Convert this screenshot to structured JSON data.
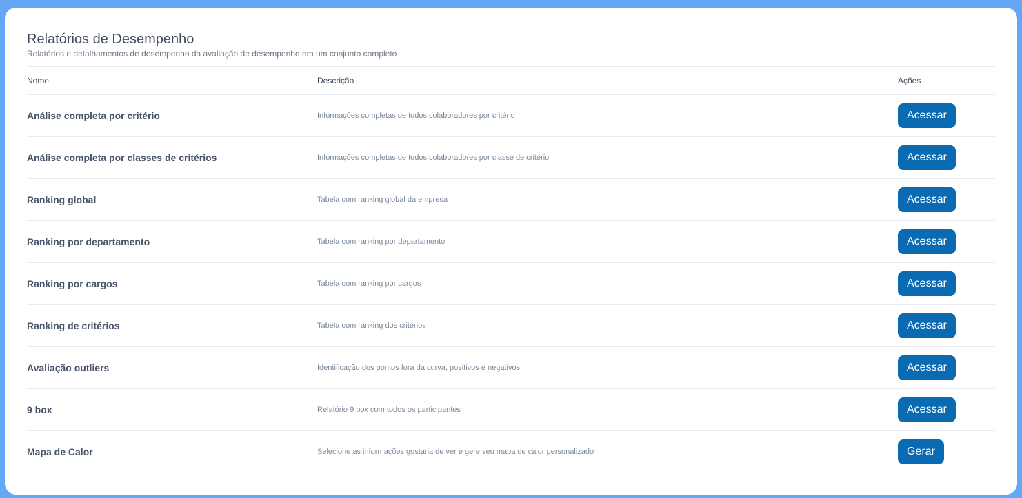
{
  "header": {
    "title": "Relatórios de Desempenho",
    "subtitle": "Relatórios e detalhamentos de desempenho da avaliação de desempenho em um conjunto completo"
  },
  "table": {
    "columns": {
      "name": "Nome",
      "description": "Descrição",
      "actions": "Ações"
    },
    "rows": [
      {
        "name": "Análise completa por critério",
        "description": "Informações completas de todos colaboradores por critério",
        "action": "Acessar"
      },
      {
        "name": "Análise completa por classes de critérios",
        "description": "Informações completas de todos colaboradores por classe de critério",
        "action": "Acessar"
      },
      {
        "name": "Ranking global",
        "description": "Tabela com ranking global da empresa",
        "action": "Acessar"
      },
      {
        "name": "Ranking por departamento",
        "description": "Tabela com ranking por departamento",
        "action": "Acessar"
      },
      {
        "name": "Ranking por cargos",
        "description": "Tabela com ranking por cargos",
        "action": "Acessar"
      },
      {
        "name": "Ranking de critérios",
        "description": "Tabela com ranking dos critérios",
        "action": "Acessar"
      },
      {
        "name": "Avaliação outliers",
        "description": "Identificação dos pontos fora da curva, positivos e negativos",
        "action": "Acessar"
      },
      {
        "name": "9 box",
        "description": "Relatório 9 box com todos os participantes",
        "action": "Acessar"
      },
      {
        "name": "Mapa de Calor",
        "description": "Selecione as informações gostaria de ver e gere seu mapa de calor personalizado",
        "action": "Gerar"
      }
    ]
  },
  "colors": {
    "background": "#64a7f7",
    "card": "#ffffff",
    "button": "#0a6ab2",
    "title": "#3d4a5c"
  }
}
